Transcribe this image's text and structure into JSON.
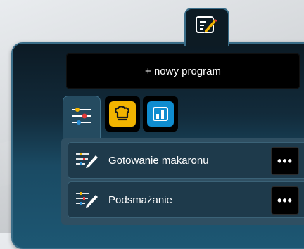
{
  "header": {
    "edit_icon": "edit-note-icon"
  },
  "actions": {
    "new_program_label": "+ nowy program"
  },
  "categories": [
    {
      "icon": "sliders-icon",
      "color": "#254b60",
      "active": true
    },
    {
      "icon": "chef-hat-icon",
      "color": "#f2b400",
      "active": false
    },
    {
      "icon": "bar-chart-icon",
      "color": "#0f8ccf",
      "active": false
    }
  ],
  "programs": [
    {
      "label": "Gotowanie makaronu",
      "icon": "program-edit-icon",
      "more_label": "•••"
    },
    {
      "label": "Podsmażanie",
      "icon": "program-edit-icon",
      "more_label": "•••"
    }
  ]
}
